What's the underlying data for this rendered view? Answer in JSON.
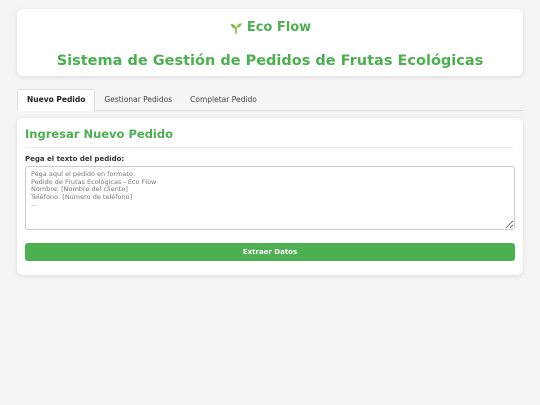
{
  "header": {
    "brand": "Eco Flow",
    "title": "Sistema de Gestión de Pedidos de Frutas Ecológicas"
  },
  "tabs": [
    {
      "label": "Nuevo Pedido",
      "active": true
    },
    {
      "label": "Gestionar Pedidos",
      "active": false
    },
    {
      "label": "Completar Pedido",
      "active": false
    }
  ],
  "new_order": {
    "section_title": "Ingresar Nuevo Pedido",
    "textarea_label": "Pega el texto del pedido:",
    "textarea_placeholder": "Pega aquí el pedido en formato:\nPedido de Frutas Ecológicas - Eco Flow\nNombre: [Nombre del cliente]\nTeléfono: [Número de teléfono]\n...",
    "textarea_value": "",
    "extract_button": "Extraer Datos"
  },
  "icons": {
    "brand_icon": "sprout-icon"
  },
  "colors": {
    "accent": "#4caf50",
    "background": "#f5f5f5"
  }
}
